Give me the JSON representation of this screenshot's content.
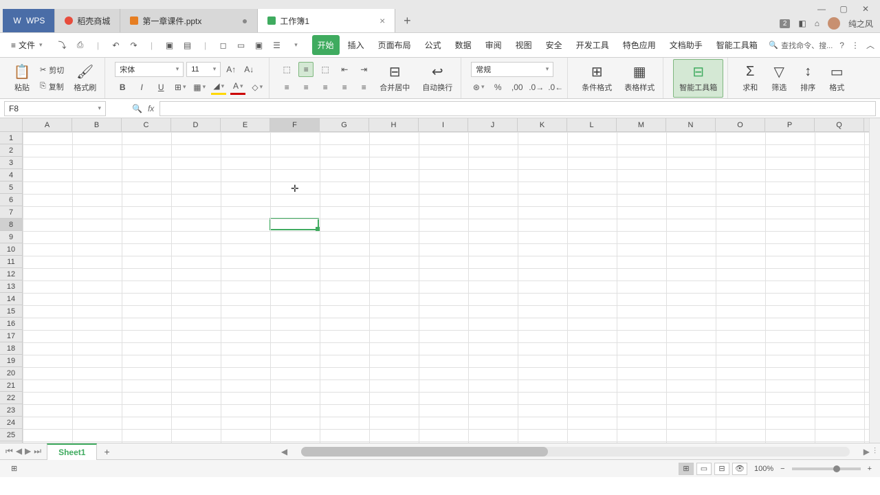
{
  "titlebar": {
    "app_tab": "WPS",
    "tabs": [
      {
        "icon_color": "#e74c3c",
        "label": "稻壳商城"
      },
      {
        "icon_color": "#e67e22",
        "label": "第一章课件.pptx"
      },
      {
        "icon_color": "#3fab5f",
        "label": "工作簿1",
        "active": true
      }
    ],
    "user_badge": "2",
    "username": "纯之风"
  },
  "menubar": {
    "file_label": "文件",
    "tabs": [
      "开始",
      "插入",
      "页面布局",
      "公式",
      "数据",
      "审阅",
      "视图",
      "安全",
      "开发工具",
      "特色应用",
      "文档助手",
      "智能工具箱"
    ],
    "active_tab": 0,
    "search_placeholder": "查找命令、搜..."
  },
  "ribbon": {
    "paste": "粘贴",
    "cut": "剪切",
    "copy": "复制",
    "format_painter": "格式刷",
    "font_name": "宋体",
    "font_size": "11",
    "merge_center": "合并居中",
    "wrap_text": "自动换行",
    "number_format": "常规",
    "cond_format": "条件格式",
    "table_style": "表格样式",
    "smart_toolbox": "智能工具箱",
    "sum": "求和",
    "filter": "筛选",
    "sort": "排序",
    "format": "格式"
  },
  "formula": {
    "name_box": "F8",
    "fx": "fx"
  },
  "grid": {
    "columns": [
      "A",
      "B",
      "C",
      "D",
      "E",
      "F",
      "G",
      "H",
      "I",
      "J",
      "K",
      "L",
      "M",
      "N",
      "O",
      "P",
      "Q"
    ],
    "rows": 25,
    "selected_col": 5,
    "selected_row": 8,
    "cursor_pos": {
      "col": 5,
      "row": 5
    }
  },
  "sheets": {
    "active": "Sheet1"
  },
  "status": {
    "zoom": "100%"
  }
}
